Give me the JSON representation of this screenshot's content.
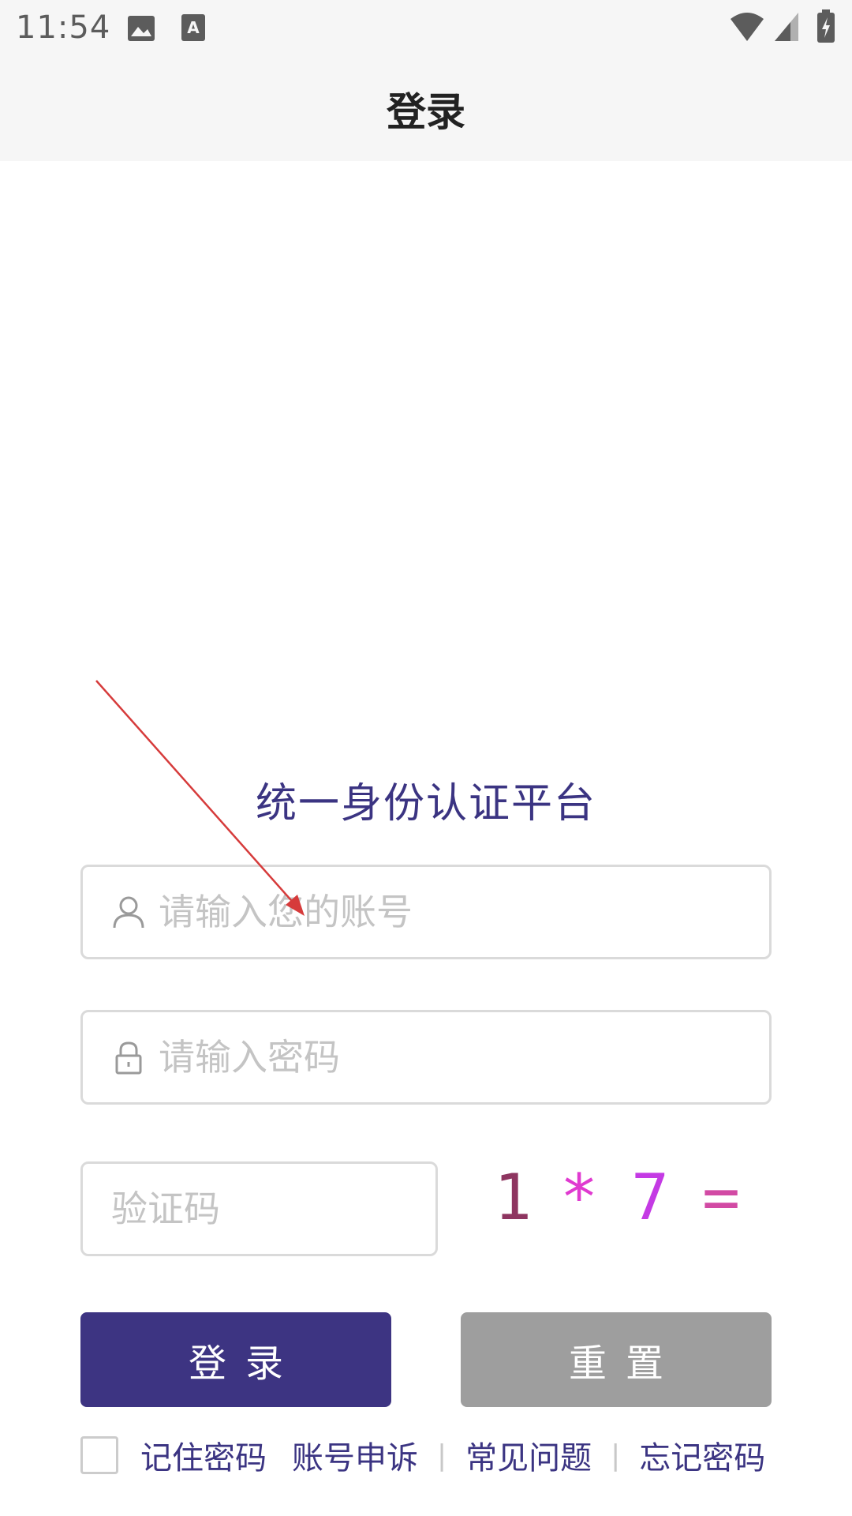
{
  "status_bar": {
    "time": "11:54",
    "icons": [
      "image-icon",
      "text-icon",
      "wifi-icon",
      "signal-icon",
      "battery-charging-icon"
    ]
  },
  "app_bar": {
    "title": "登录"
  },
  "form": {
    "platform_title": "统一身份认证平台",
    "account_placeholder": "请输入您的账号",
    "password_placeholder": "请输入密码",
    "captcha_placeholder": "验证码",
    "captcha_chars": [
      "1",
      "*",
      "7",
      "="
    ],
    "captcha_colors": [
      "#8e3560",
      "#e03ad0",
      "#c43ae4",
      "#d24aa4"
    ],
    "login_label": "登录",
    "reset_label": "重置"
  },
  "footer": {
    "remember_label": "记住密码",
    "appeal_label": "账号申诉",
    "faq_label": "常见问题",
    "forgot_label": "忘记密码",
    "separator": "|"
  },
  "colors": {
    "primary": "#3d3482",
    "reset_gray": "#9e9e9e",
    "annotation_red": "#d63b3b"
  }
}
